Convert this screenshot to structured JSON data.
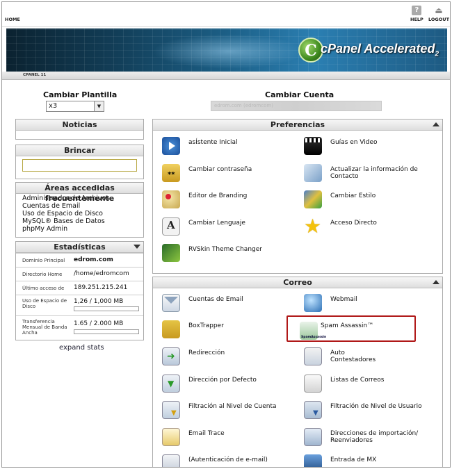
{
  "topbar": {
    "home": "HOME",
    "help": "HELP",
    "logout": "LOGOUT"
  },
  "banner": {
    "logo_letter": "C",
    "logo_text": "cPanel",
    "logo_accent": "Accelerated",
    "logo_version": "2",
    "brand_color": "#4f9a2a"
  },
  "tab": {
    "label": "CPANEL 11"
  },
  "theme": {
    "label": "Cambiar Plantilla",
    "value": "x3"
  },
  "account": {
    "label": "Cambiar Cuenta",
    "value": "edrom.com (edromcom)"
  },
  "sidebar": {
    "news_title": "Noticias",
    "jump_title": "Brincar",
    "frequent_title": "Áreas accedidas frecuentemente",
    "frequent_items": [
      "Administrador de Archivos",
      "Cuentas de Email",
      "Uso de Espacio de Disco",
      "MySQL® Bases de Datos",
      "phpMy Admin"
    ],
    "stats_title": "Estadísticas",
    "stats": [
      {
        "key": "Dominio Principal",
        "value": "edrom.com"
      },
      {
        "key": "Directorio Home",
        "value": "/home/edromcom"
      },
      {
        "key": "Último acceso de",
        "value": "189.251.215.241"
      },
      {
        "key": "Uso de Espacio de Disco",
        "value": "1,26 / 1,000 MB",
        "fraction": 0.00126
      },
      {
        "key": "Transferencia Mensual de Banda Ancha",
        "value": "1.65 / 2.000 MB",
        "fraction": 0.000825
      }
    ],
    "expand_stats": "expand stats"
  },
  "preferences": {
    "title": "Preferencias",
    "items": [
      {
        "label": "asÍstente Inicial",
        "icon": "video-play-icon"
      },
      {
        "label": "Guías en Video",
        "icon": "film-clapper-icon"
      },
      {
        "label": "Cambiar contraseña",
        "icon": "lock-password-icon"
      },
      {
        "label": "Actualizar la información de Contacto",
        "icon": "contact-update-icon"
      },
      {
        "label": "Editor de Branding",
        "icon": "palette-icon"
      },
      {
        "label": "Cambiar Estilo",
        "icon": "style-icon"
      },
      {
        "label": "Cambiar Lenguaje",
        "icon": "language-icon"
      },
      {
        "label": "Acceso Directo",
        "icon": "star-icon"
      },
      {
        "label": "RVSkin Theme Changer",
        "icon": "rvskin-icon"
      }
    ]
  },
  "mail": {
    "title": "Correo",
    "items": [
      {
        "label": "Cuentas de Email",
        "icon": "envelope-icon"
      },
      {
        "label": "Webmail",
        "icon": "globe-mail-icon"
      },
      {
        "label": "BoxTrapper",
        "icon": "boxtrapper-icon"
      },
      {
        "label": "Spam Assassin™",
        "icon": "spamassassin-icon"
      },
      {
        "label": "Redirección",
        "icon": "forward-icon"
      },
      {
        "label": "Auto Contestadores",
        "icon": "autoresponder-icon"
      },
      {
        "label": "Dirección por Defecto",
        "icon": "default-address-icon"
      },
      {
        "label": "Listas de Correos",
        "icon": "mailing-lists-icon"
      },
      {
        "label": "Filtración al Nivel de Cuenta",
        "icon": "account-filter-icon"
      },
      {
        "label": "Filtración de Nivel de Usuario",
        "icon": "user-filter-icon"
      },
      {
        "label": "Email Trace",
        "icon": "email-trace-icon"
      },
      {
        "label": "Direcciones de importación/ Reenviadores",
        "icon": "import-icon"
      },
      {
        "label": "(Autenticación de e-mail)",
        "icon": "email-auth-icon"
      },
      {
        "label": "Entrada de MX",
        "icon": "mx-entry-icon"
      }
    ]
  },
  "highlight_color": "#b01818"
}
